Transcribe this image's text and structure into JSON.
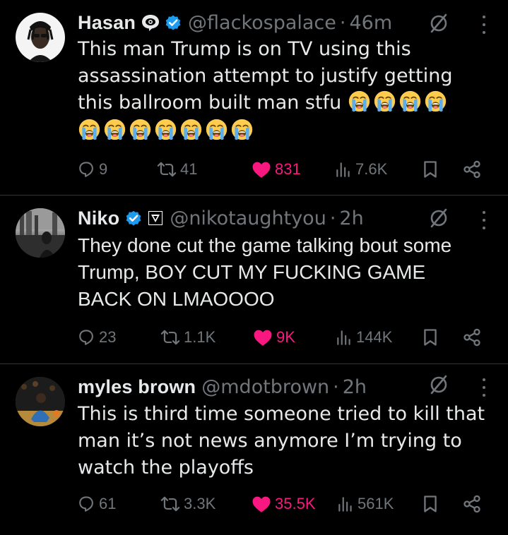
{
  "colors": {
    "background": "#000000",
    "text_primary": "#e7e9ea",
    "text_secondary": "#71767b",
    "verified_blue": "#1d9bf0",
    "like_pink": "#f91880",
    "divider": "#2f3336"
  },
  "tweets": [
    {
      "display_name": "Hasan",
      "handle": "@flackospalace",
      "separator": "·",
      "time": "46m",
      "text_lines": [
        "This man Trump is on TV using this",
        "assassination attempt to justify getting",
        "this ballroom built man stfu"
      ],
      "emoji_name": "loudly-crying-face",
      "emoji_count": 11,
      "replies": "9",
      "reposts": "41",
      "likes": "831",
      "views": "7.6K",
      "liked": true
    },
    {
      "display_name": "Niko",
      "handle": "@nikotaughtyou",
      "separator": "·",
      "time": "2h",
      "text_lines": [
        "They done cut the game talking bout some",
        "Trump, BOY CUT MY FUCKING GAME",
        "BACK ON LMAOOOO"
      ],
      "replies": "23",
      "reposts": "1.1K",
      "likes": "9K",
      "views": "144K",
      "liked": true
    },
    {
      "display_name": "myles brown",
      "handle": "@mdotbrown",
      "separator": "·",
      "time": "2h",
      "text_lines": [
        "This is third time someone tried to kill that",
        "man it’s not news anymore I’m trying to",
        "watch the playoffs"
      ],
      "replies": "61",
      "reposts": "3.3K",
      "likes": "35.5K",
      "views": "561K",
      "liked": true
    }
  ]
}
